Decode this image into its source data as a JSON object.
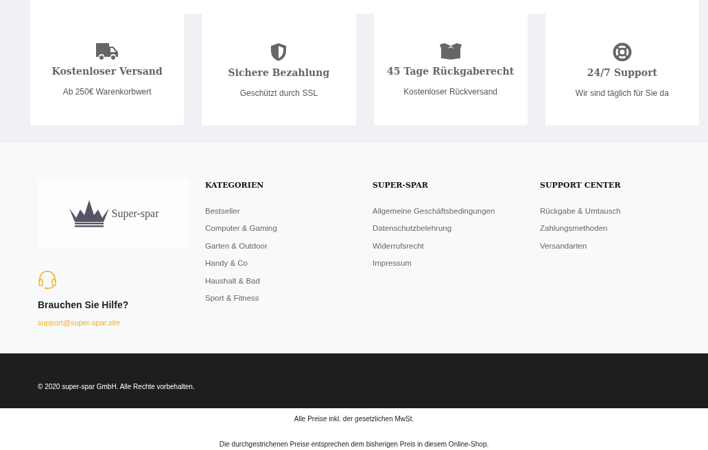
{
  "features": [
    {
      "title": "Kostenloser Versand",
      "subtitle": "Ab 250€ Warenkorbwert"
    },
    {
      "title": "Sichere Bezahlung",
      "subtitle": "Geschützt durch SSL"
    },
    {
      "title": "45 Tage Rückgaberecht",
      "subtitle": "Kostenloser Rückversand"
    },
    {
      "title": "24/7 Support",
      "subtitle": "Wir sind täglich für Sie da"
    }
  ],
  "footer": {
    "logo_text": "Super-spar",
    "help": {
      "title": "Brauchen Sie Hilfe?",
      "email": "support@super-spar.site"
    },
    "columns": [
      {
        "heading": "KATEGORIEN",
        "links": [
          "Bestseller",
          "Computer & Gaming",
          "Garten & Outdoor",
          "Handy & Co",
          "Haushalt & Bad",
          "Sport & Fitness"
        ]
      },
      {
        "heading": "SUPER-SPAR",
        "links": [
          "Allgemeine Geschäftsbedingungen",
          "Datenschutzbelehrung",
          "Widerrufsrecht",
          "Impressum"
        ]
      },
      {
        "heading": "SUPPORT CENTER",
        "links": [
          "Rückgabe & Umtausch",
          "Zahlungsmethoden",
          "Versandarten"
        ]
      }
    ]
  },
  "copyright": "© 2020 super-spar GmbH. Alle Rechte vorbehalten.",
  "notes": [
    "Alle Preise inkl. der gesetzlichen MwSt.",
    "Die durchgestrichenen Preise entsprechen dem bisherigen Preis in diesem Online-Shop."
  ]
}
